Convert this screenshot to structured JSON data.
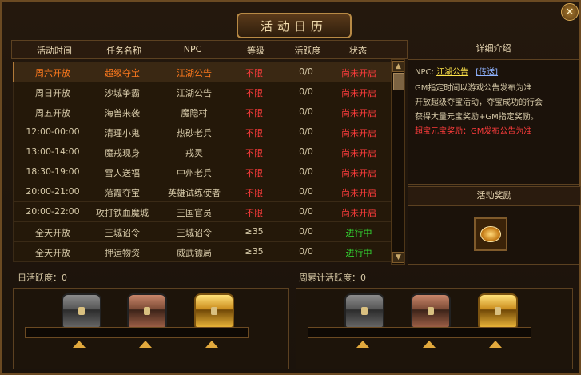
{
  "window": {
    "title": "活动日历",
    "close_glyph": "✕"
  },
  "table": {
    "headers": [
      "活动时间",
      "任务名称",
      "NPC",
      "等级",
      "活跃度",
      "状态"
    ],
    "rows": [
      {
        "time": "周六开放",
        "name": "超级夺宝",
        "npc": "江湖公告",
        "level": "不限",
        "active": "0/0",
        "status": "尚未开启",
        "selected": true
      },
      {
        "time": "周日开放",
        "name": "沙城争霸",
        "npc": "江湖公告",
        "level": "不限",
        "active": "0/0",
        "status": "尚未开启"
      },
      {
        "time": "周五开放",
        "name": "海兽来袭",
        "npc": "魔隐村",
        "level": "不限",
        "active": "0/0",
        "status": "尚未开启"
      },
      {
        "time": "12:00-00:00",
        "name": "清理小鬼",
        "npc": "热砂老兵",
        "level": "不限",
        "active": "0/0",
        "status": "尚未开启"
      },
      {
        "time": "13:00-14:00",
        "name": "魔戒现身",
        "npc": "戒灵",
        "level": "不限",
        "active": "0/0",
        "status": "尚未开启"
      },
      {
        "time": "18:30-19:00",
        "name": "雪人送福",
        "npc": "中州老兵",
        "level": "不限",
        "active": "0/0",
        "status": "尚未开启"
      },
      {
        "time": "20:00-21:00",
        "name": "落霞夺宝",
        "npc": "英雄试练使者",
        "level": "不限",
        "active": "0/0",
        "status": "尚未开启"
      },
      {
        "time": "20:00-22:00",
        "name": "攻打铁血魔城",
        "npc": "王国官员",
        "level": "不限",
        "active": "0/0",
        "status": "尚未开启"
      },
      {
        "time": "全天开放",
        "name": "王城诏令",
        "npc": "王城诏令",
        "level": "≥35",
        "active": "0/0",
        "status": "进行中"
      },
      {
        "time": "全天开放",
        "name": "押运物资",
        "npc": "威武镖局",
        "level": "≥35",
        "active": "0/0",
        "status": "进行中"
      }
    ]
  },
  "detail": {
    "title": "详细介绍",
    "npc_prefix": "NPC:",
    "npc_name": "江湖公告",
    "teleport": "[传送]",
    "line1": "GM指定时间以游戏公告发布为准",
    "line2": "开放超级夺宝活动，夺宝成功的行会",
    "line3": "获得大量元宝奖励+GM指定奖励。",
    "line4": "超宝元宝奖励：GM发布公告为准"
  },
  "reward": {
    "title": "活动奖励",
    "icon": "gold-ingot-icon"
  },
  "daily": {
    "label": "日活跃度：0",
    "progress": 0
  },
  "weekly": {
    "label": "周累计活跃度：0",
    "progress": 0
  },
  "colors": {
    "status_pending": "#ff3c3c",
    "status_active": "#35e335",
    "selected_text": "#ff7a1e"
  }
}
